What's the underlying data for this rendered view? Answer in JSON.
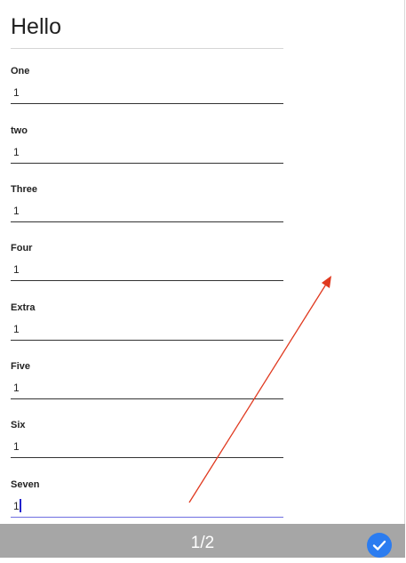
{
  "form": {
    "title": "Hello",
    "fields": [
      {
        "label": "One",
        "value": "1"
      },
      {
        "label": "two",
        "value": "1"
      },
      {
        "label": "Three",
        "value": "1"
      },
      {
        "label": "Four",
        "value": "1"
      },
      {
        "label": "Extra",
        "value": "1"
      },
      {
        "label": "Five",
        "value": "1"
      },
      {
        "label": "Six",
        "value": "1"
      },
      {
        "label": "Seven",
        "value": "1"
      }
    ]
  },
  "footer": {
    "page_indicator": "1/2",
    "confirm_icon": "check-icon",
    "accent_color": "#2b7cf0"
  },
  "annotation": {
    "arrow_icon": "arrow-icon",
    "color": "#e0391f"
  }
}
